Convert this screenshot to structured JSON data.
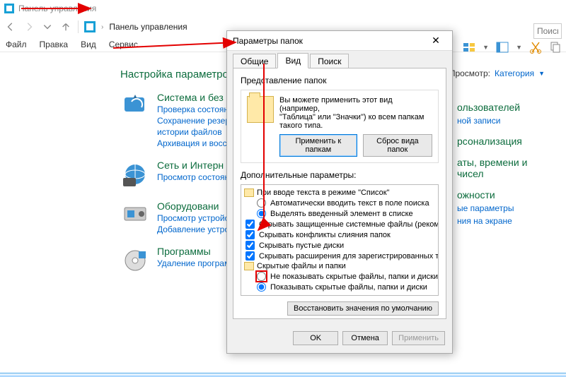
{
  "window": {
    "title": "Панель управления"
  },
  "nav": {
    "breadcrumb": "Панель управления",
    "search_placeholder": "Поиск"
  },
  "menu": {
    "file": "Файл",
    "edit": "Правка",
    "view": "Вид",
    "service": "Сервис"
  },
  "viewrow": {
    "label": "Просмотр:",
    "value": "Категория"
  },
  "cp": {
    "heading": "Настройка параметров"
  },
  "cats": [
    {
      "title": "Система и без",
      "links": [
        "Проверка состояни",
        "Сохранение резерв",
        "истории файлов",
        "Архивация и восст"
      ]
    },
    {
      "title": "Сеть и Интерн",
      "links": [
        "Просмотр состояни"
      ]
    },
    {
      "title": "Оборудовани",
      "links": [
        "Просмотр устройст",
        "Добавление устрой"
      ]
    },
    {
      "title": "Программы",
      "links": [
        "Удаление програм"
      ]
    }
  ],
  "rightcats": [
    {
      "title": "ользователей",
      "links": [
        "ной записи"
      ]
    },
    {
      "title": "рсонализация",
      "links": []
    },
    {
      "title": "аты, времени и чисел",
      "links": []
    },
    {
      "title": "ожности",
      "links": [
        "ые параметры",
        "ния на экране"
      ]
    }
  ],
  "dialog": {
    "title": "Параметры папок",
    "tabs": {
      "general": "Общие",
      "view": "Вид",
      "search": "Поиск"
    },
    "folder_view": {
      "section": "Представление папок",
      "text1": "Вы можете применить этот вид (например,",
      "text2": "\"Таблица\" или \"Значки\") ко всем папкам",
      "text3": "такого типа.",
      "apply_btn": "Применить к папкам",
      "reset_btn": "Сброс вида папок"
    },
    "advanced": {
      "label": "Дополнительные параметры:",
      "items": [
        {
          "type": "folder",
          "indent": 0,
          "text": "При вводе текста в режиме \"Список\""
        },
        {
          "type": "radio",
          "indent": 1,
          "checked": false,
          "text": "Автоматически вводить текст в поле поиска"
        },
        {
          "type": "radio",
          "indent": 1,
          "checked": true,
          "text": "Выделять введенный элемент в списке"
        },
        {
          "type": "check",
          "indent": 0,
          "checked": true,
          "text": "Скрывать защищенные системные файлы (рекомен,"
        },
        {
          "type": "check",
          "indent": 0,
          "checked": true,
          "text": "Скрывать конфликты слияния папок"
        },
        {
          "type": "check",
          "indent": 0,
          "checked": true,
          "text": "Скрывать пустые диски"
        },
        {
          "type": "check",
          "indent": 0,
          "checked": true,
          "text": "Скрывать расширения для зарегистрированных типо"
        },
        {
          "type": "folder",
          "indent": 0,
          "text": "Скрытые файлы и папки"
        },
        {
          "type": "radio",
          "indent": 1,
          "checked": false,
          "red": true,
          "text": "Не показывать скрытые файлы, папки и диски"
        },
        {
          "type": "radio",
          "indent": 1,
          "checked": true,
          "text": "Показывать скрытые файлы, папки и диски"
        }
      ],
      "restore_btn": "Восстановить значения по умолчанию"
    },
    "footer": {
      "ok": "OK",
      "cancel": "Отмена",
      "apply": "Применить"
    }
  }
}
